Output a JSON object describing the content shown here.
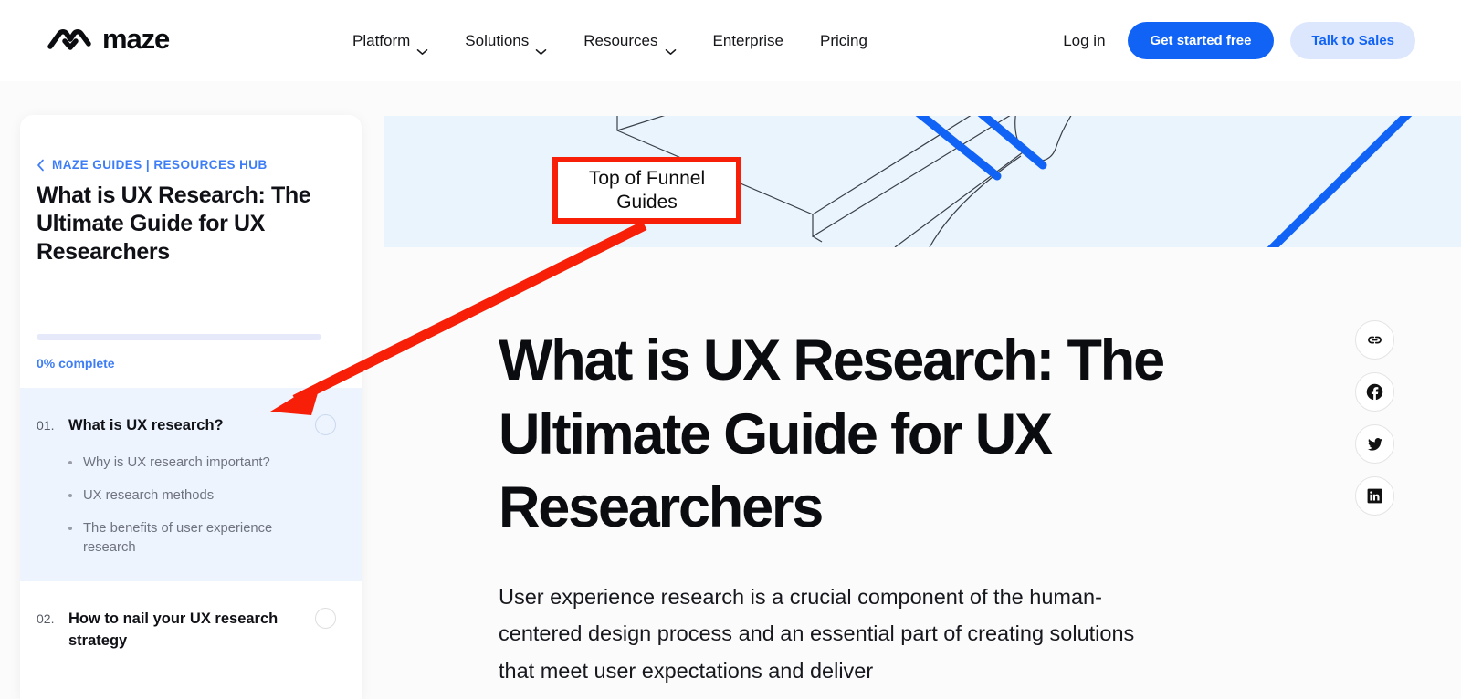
{
  "header": {
    "logo_text": "maze",
    "logo_icon": "maze-logo-mark",
    "nav": [
      {
        "label": "Platform",
        "has_dropdown": true
      },
      {
        "label": "Solutions",
        "has_dropdown": true
      },
      {
        "label": "Resources",
        "has_dropdown": true
      },
      {
        "label": "Enterprise",
        "has_dropdown": false
      },
      {
        "label": "Pricing",
        "has_dropdown": false
      }
    ],
    "login_label": "Log in",
    "cta_primary": "Get started free",
    "cta_secondary": "Talk to Sales",
    "accent_blue": "#1163f6",
    "secondary_bg": "#dce7fd"
  },
  "sidebar": {
    "breadcrumb": "MAZE GUIDES | RESOURCES HUB",
    "breadcrumb_icon": "chevron-left-icon",
    "guide_title": "What is UX Research: The Ultimate Guide for UX Researchers",
    "progress_percent": 0,
    "progress_label": "0% complete",
    "progress_color": "#3d7df6",
    "toc": [
      {
        "number": "01.",
        "label": "What is UX research?",
        "active": true,
        "subitems": [
          "Why is UX research important?",
          "UX research methods",
          "The benefits of user experience research"
        ]
      },
      {
        "number": "02.",
        "label": "How to nail your UX research strategy",
        "active": false,
        "subitems": []
      }
    ]
  },
  "main": {
    "banner_bg": "#e9f4fd",
    "banner_icon": "line-art-desk-illustration",
    "article_title": "What is UX Research: The Ultimate Guide for UX Researchers",
    "article_body": "User experience research is a crucial component of the human-centered design process and an essential part of creating solutions that meet user expectations and deliver"
  },
  "share_rail": [
    {
      "name": "copy-link-icon",
      "label": "Copy link"
    },
    {
      "name": "facebook-icon",
      "label": "Facebook"
    },
    {
      "name": "twitter-icon",
      "label": "Twitter"
    },
    {
      "name": "linkedin-icon",
      "label": "LinkedIn"
    }
  ],
  "annotation": {
    "callout_text": "Top of Funnel Guides",
    "callout_color": "#f71f07"
  }
}
